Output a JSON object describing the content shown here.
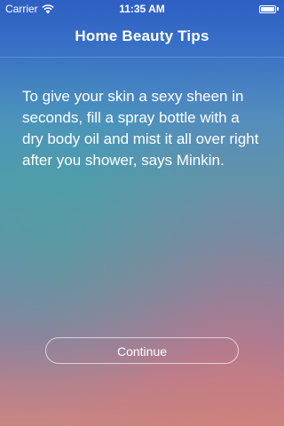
{
  "status_bar": {
    "carrier": "Carrier",
    "time": "11:35 AM",
    "icons": [
      "wifi-icon",
      "battery-icon"
    ]
  },
  "nav": {
    "title": "Home Beauty Tips"
  },
  "tip": {
    "text": "To give your skin a sexy sheen in seconds, fill a spray bottle with a dry body oil and mist it all over right after you shower, says Minkin."
  },
  "actions": {
    "continue_label": "Continue"
  },
  "colors": {
    "gradient_top": "#2d5fc4",
    "gradient_mid": "#4e97b4",
    "gradient_bottom": "#c88683",
    "text": "#ffffff"
  }
}
